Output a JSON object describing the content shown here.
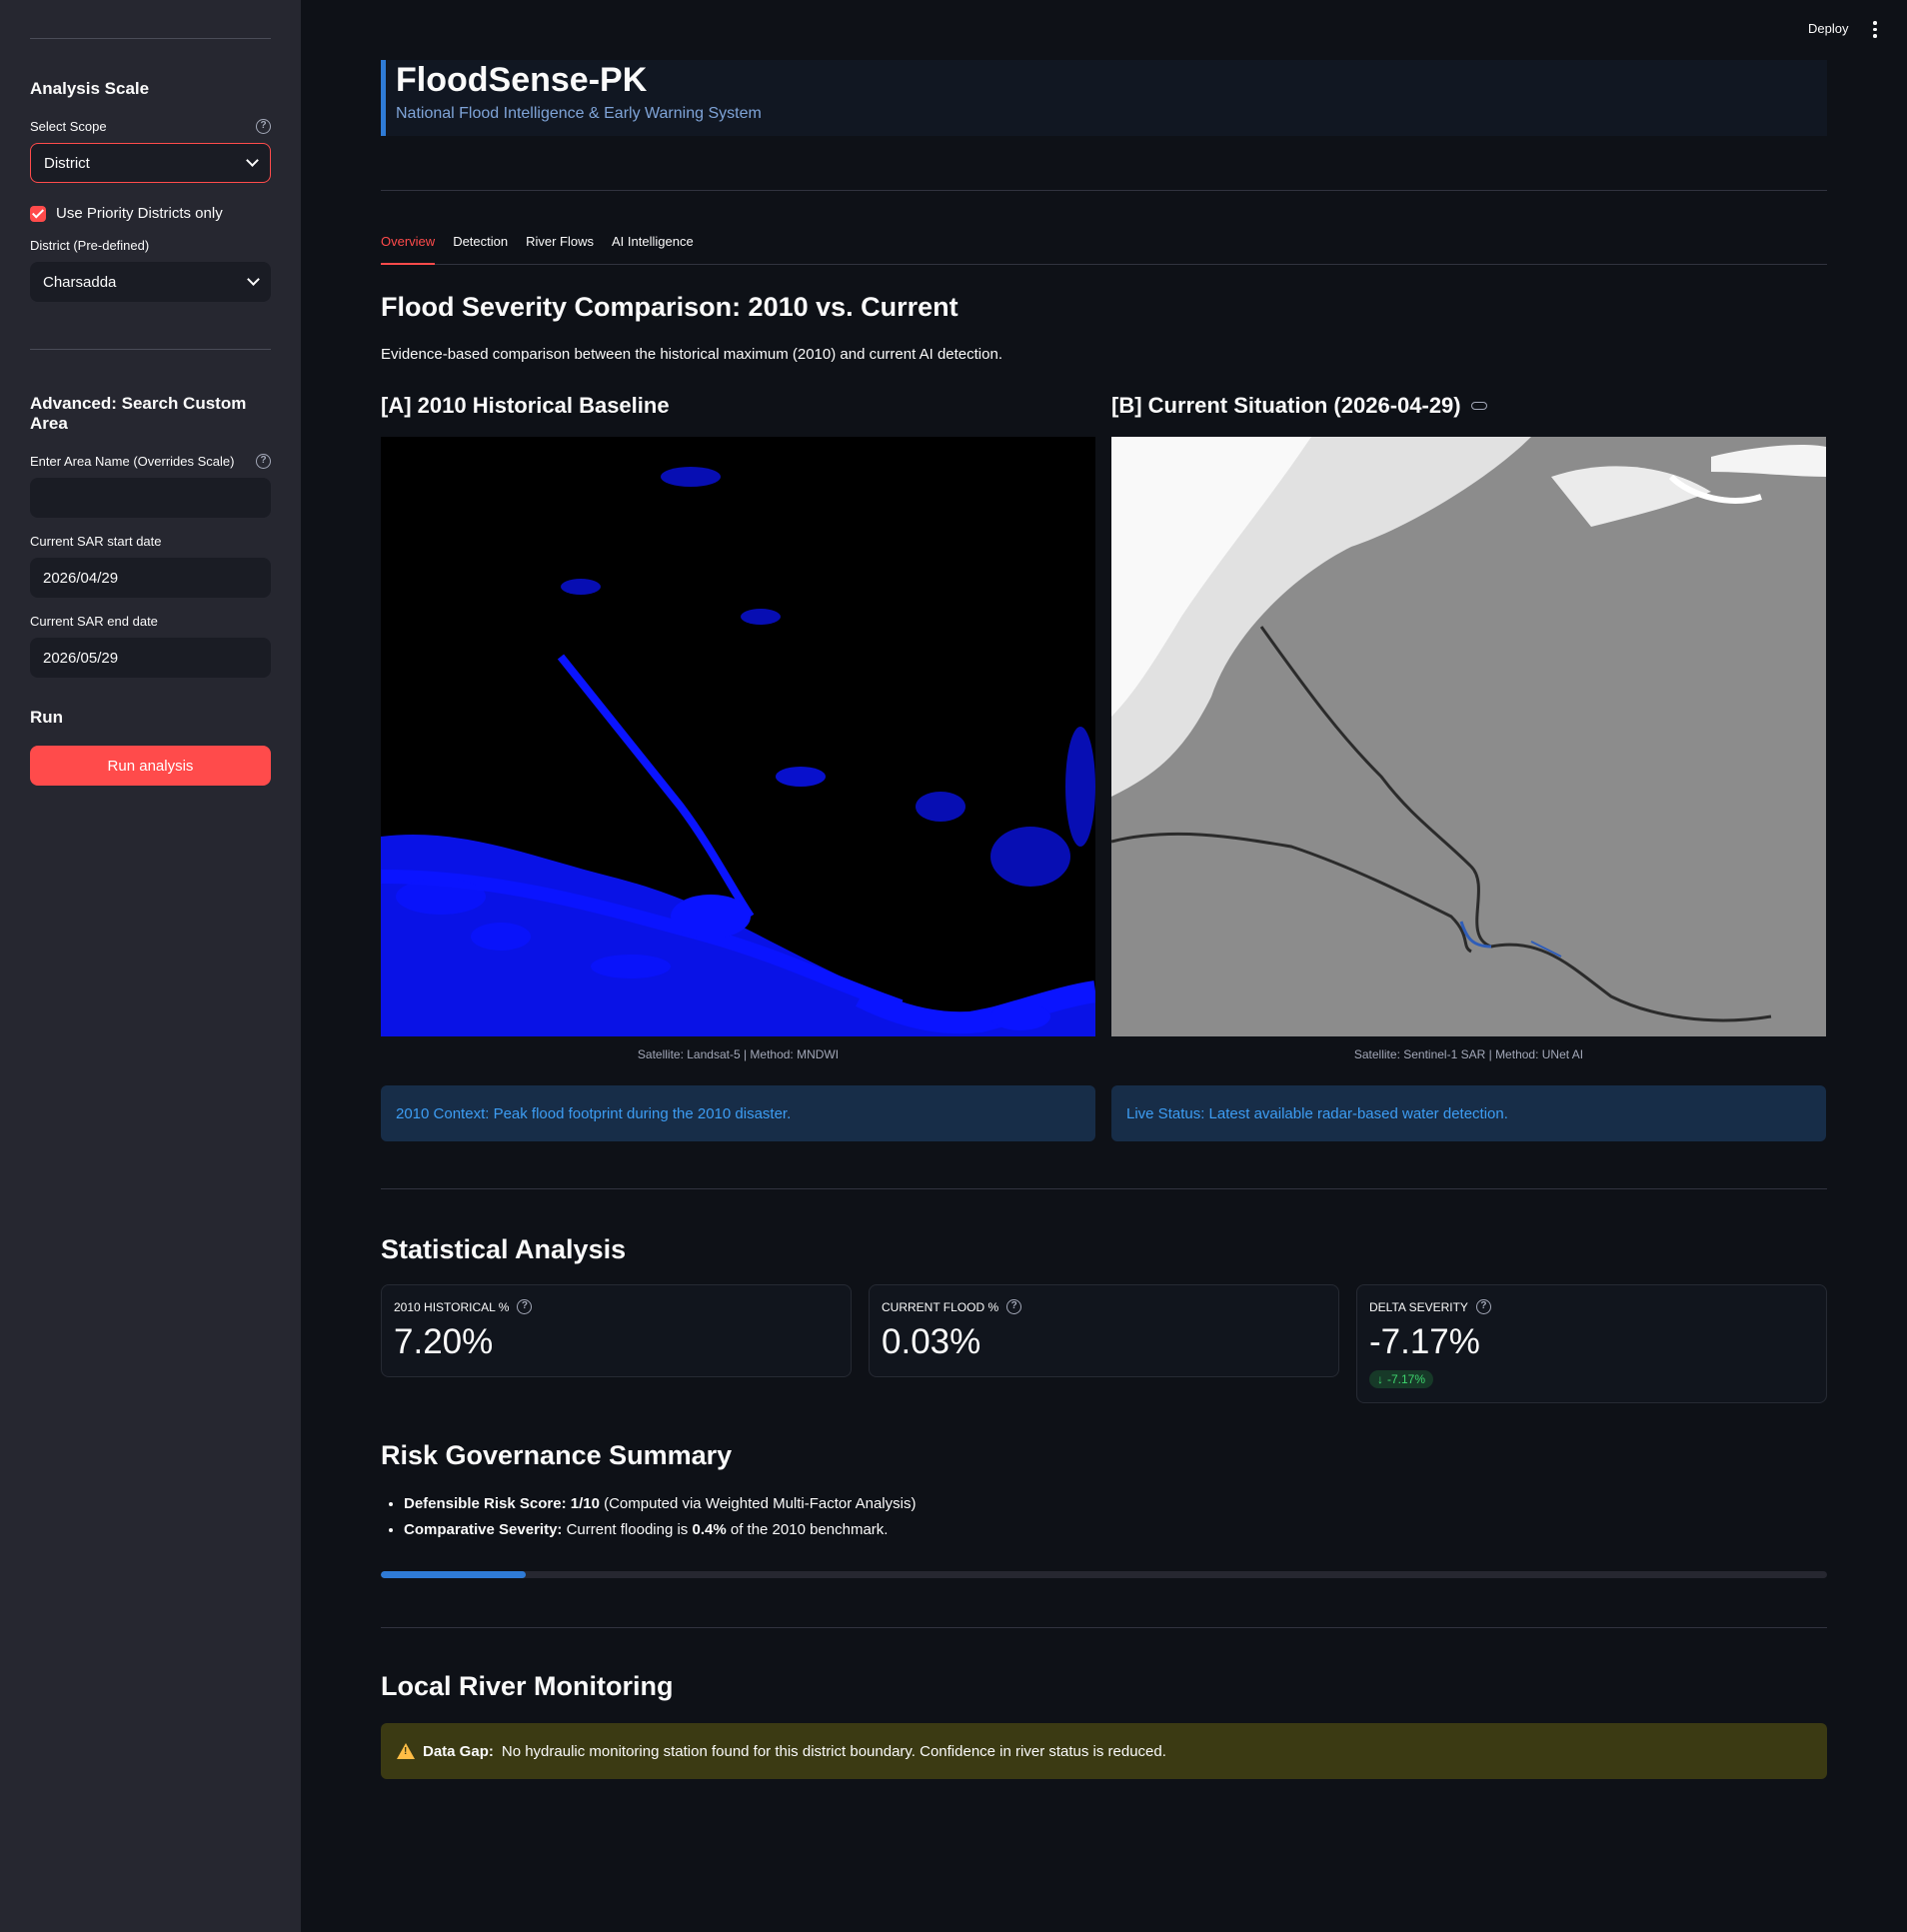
{
  "topbar": {
    "deploy_label": "Deploy"
  },
  "sidebar": {
    "analysis_scale_heading": "Analysis Scale",
    "select_scope_label": "Select Scope",
    "select_scope_value": "District",
    "priority_checkbox_label": "Use Priority Districts only",
    "district_label": "District (Pre-defined)",
    "district_value": "Charsadda",
    "advanced_heading": "Advanced: Search Custom Area",
    "area_name_label": "Enter Area Name (Overrides Scale)",
    "area_name_value": "",
    "sar_start_label": "Current SAR start date",
    "sar_start_value": "2026/04/29",
    "sar_end_label": "Current SAR end date",
    "sar_end_value": "2026/05/29",
    "run_heading": "Run",
    "run_button_label": "Run analysis"
  },
  "header": {
    "title": "FloodSense-PK",
    "subtitle": "National Flood Intelligence & Early Warning System"
  },
  "tabs": [
    {
      "label": "Overview",
      "active": true
    },
    {
      "label": "Detection",
      "active": false
    },
    {
      "label": "River Flows",
      "active": false
    },
    {
      "label": "AI Intelligence",
      "active": false
    }
  ],
  "comparison": {
    "heading": "Flood Severity Comparison: 2010 vs. Current",
    "description": "Evidence-based comparison between the historical maximum (2010) and current AI detection.",
    "baseline": {
      "title": "[A] 2010 Historical Baseline",
      "caption": "Satellite: Landsat-5 | Method: MNDWI",
      "info": "2010 Context: Peak flood footprint during the 2010 disaster."
    },
    "current": {
      "title": "[B] Current Situation (2026-04-29)",
      "caption": "Satellite: Sentinel-1 SAR | Method: UNet AI",
      "info": "Live Status: Latest available radar-based water detection."
    }
  },
  "stats": {
    "heading": "Statistical Analysis",
    "metrics": [
      {
        "label": "2010 HISTORICAL %",
        "value": "7.20%"
      },
      {
        "label": "CURRENT FLOOD %",
        "value": "0.03%"
      },
      {
        "label": "DELTA SEVERITY",
        "value": "-7.17%",
        "delta": "-7.17%"
      }
    ]
  },
  "risk": {
    "heading": "Risk Governance Summary",
    "bullet1_bold": "Defensible Risk Score:",
    "bullet1_score": "1/10",
    "bullet1_rest": "(Computed via Weighted Multi-Factor Analysis)",
    "bullet2_bold": "Comparative Severity:",
    "bullet2_pre": "Current flooding is",
    "bullet2_value": "0.4%",
    "bullet2_post": "of the 2010 benchmark.",
    "progress_fraction": 0.1
  },
  "river": {
    "heading": "Local River Monitoring",
    "warning_bold": "Data Gap:",
    "warning_text": "No hydraulic monitoring station found for this district boundary. Confidence in river status is reduced."
  },
  "colors": {
    "accent": "#ff4b4b",
    "info_text": "#3d9df3",
    "progress": "#2f7bd6",
    "flood_blue": "#0a14ff"
  }
}
